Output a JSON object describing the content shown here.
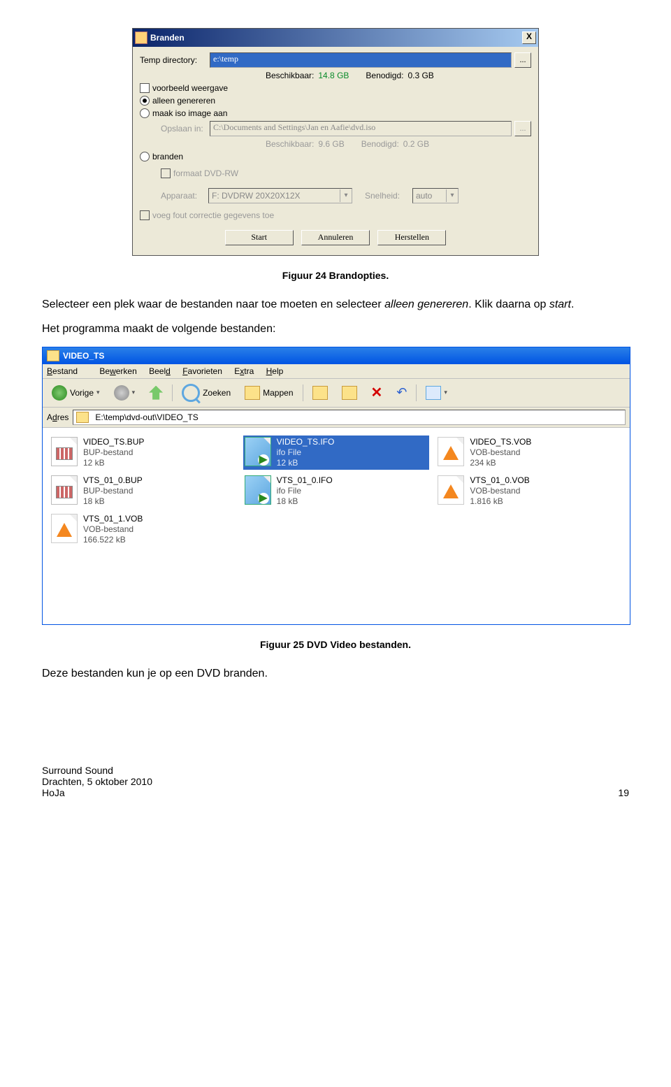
{
  "dialog": {
    "title": "Branden",
    "close": "X",
    "temp_dir_label": "Temp directory:",
    "temp_dir_value": "e:\\temp",
    "browse": "...",
    "avail_label": "Beschikbaar:",
    "avail_value": "14.8 GB",
    "need_label": "Benodigd:",
    "need_value": "0.3 GB",
    "chk_preview": "voorbeeld weergave",
    "radio_generate": "alleen genereren",
    "radio_iso": "maak iso image aan",
    "save_in_label": "Opslaan in:",
    "save_in_value": "C:\\Documents and Settings\\Jan en Aafie\\dvd.iso",
    "avail2_label": "Beschikbaar:",
    "avail2_value": "9.6 GB",
    "need2_label": "Benodigd:",
    "need2_value": "0.2 GB",
    "radio_burn": "branden",
    "chk_format": "formaat DVD-RW",
    "device_label": "Apparaat:",
    "device_value": "F: DVDRW 20X20X12X",
    "speed_label": "Snelheid:",
    "speed_value": "auto",
    "chk_ecc": "voeg fout correctie gegevens toe",
    "btn_start": "Start",
    "btn_cancel": "Annuleren",
    "btn_reset": "Herstellen"
  },
  "caption1": "Figuur 24 Brandopties.",
  "paragraph1_a": "Selecteer een plek waar de bestanden naar toe moeten en selecteer ",
  "paragraph1_em1": "alleen genereren",
  "paragraph1_b": ". Klik daarna op ",
  "paragraph1_em2": "start",
  "paragraph1_c": ".",
  "paragraph2": "Het programma maakt de volgende bestanden:",
  "explorer": {
    "title": "VIDEO_TS",
    "menu": {
      "m1": "Bestand",
      "m2": "Bewerken",
      "m3": "Beeld",
      "m4": "Favorieten",
      "m5": "Extra",
      "m6": "Help"
    },
    "tb": {
      "back": "Vorige",
      "search": "Zoeken",
      "folders": "Mappen"
    },
    "addr_label": "Adres",
    "addr_value": "E:\\temp\\dvd-out\\VIDEO_TS",
    "files": [
      {
        "name": "VIDEO_TS.BUP",
        "type": "BUP-bestand",
        "size": "12 kB",
        "icon": "bup",
        "sel": false
      },
      {
        "name": "VIDEO_TS.IFO",
        "type": "ifo File",
        "size": "12 kB",
        "icon": "ifo",
        "sel": true
      },
      {
        "name": "VIDEO_TS.VOB",
        "type": "VOB-bestand",
        "size": "234 kB",
        "icon": "vob",
        "sel": false
      },
      {
        "name": "VTS_01_0.BUP",
        "type": "BUP-bestand",
        "size": "18 kB",
        "icon": "bup",
        "sel": false
      },
      {
        "name": "VTS_01_0.IFO",
        "type": "ifo File",
        "size": "18 kB",
        "icon": "ifo",
        "sel": false
      },
      {
        "name": "VTS_01_0.VOB",
        "type": "VOB-bestand",
        "size": "1.816 kB",
        "icon": "vob",
        "sel": false
      },
      {
        "name": "VTS_01_1.VOB",
        "type": "VOB-bestand",
        "size": "166.522 kB",
        "icon": "vob",
        "sel": false
      }
    ]
  },
  "caption2": "Figuur 25 DVD Video bestanden.",
  "paragraph3": "Deze bestanden kun je op een DVD branden.",
  "footer": {
    "line1": "Surround Sound",
    "line2": "Drachten, 5 oktober 2010",
    "line3": "HoJa",
    "page": "19"
  }
}
